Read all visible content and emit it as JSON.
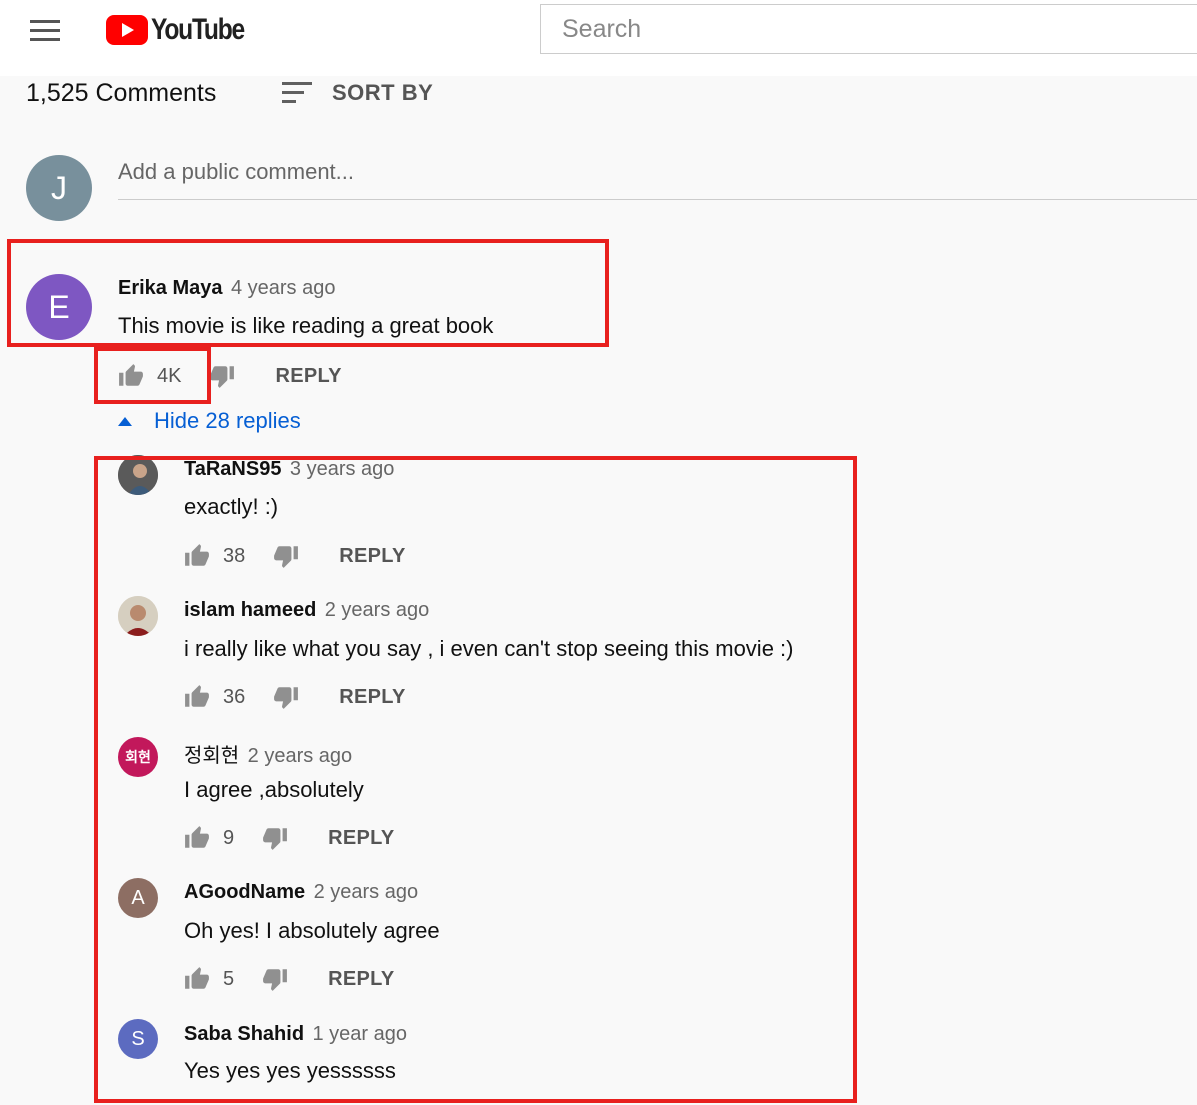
{
  "header": {
    "logo_text": "YouTube",
    "search_placeholder": "Search"
  },
  "comments_header": {
    "count_text": "1,525 Comments",
    "sort_label": "SORT BY"
  },
  "add_comment": {
    "avatar_letter": "J",
    "placeholder": "Add a public comment..."
  },
  "top_comment": {
    "avatar_letter": "E",
    "author": "Erika Maya",
    "time": "4 years ago",
    "text": "This movie is like reading a great book",
    "likes": "4K",
    "reply_label": "REPLY",
    "hide_replies_label": "Hide 28 replies"
  },
  "replies": [
    {
      "author": "TaRaNS95",
      "time": "3 years ago",
      "text": "exactly! :)",
      "likes": "38",
      "reply_label": "REPLY"
    },
    {
      "author": "islam hameed",
      "time": "2 years ago",
      "text": "i really like what you say , i even can't stop seeing this movie  :)",
      "likes": "36",
      "reply_label": "REPLY"
    },
    {
      "author": "정회현",
      "avatar_text": "회현",
      "time": "2 years ago",
      "text": "I agree ,absolutely",
      "likes": "9",
      "reply_label": "REPLY"
    },
    {
      "author": "AGoodName",
      "avatar_letter": "A",
      "time": "2 years ago",
      "text": "Oh yes! I absolutely agree",
      "likes": "5",
      "reply_label": "REPLY"
    },
    {
      "author": "Saba Shahid",
      "avatar_letter": "S",
      "time": "1 year ago",
      "text": "Yes yes yes yessssss"
    }
  ],
  "colors": {
    "highlight": "#e8201e",
    "link_blue": "#065fd4",
    "avatar_j": "#78909c",
    "avatar_e": "#7e57c2",
    "avatar_korean": "#c2185b",
    "avatar_a": "#8d6e63",
    "avatar_s": "#5c6bc0",
    "youtube_red": "#ff0000"
  }
}
